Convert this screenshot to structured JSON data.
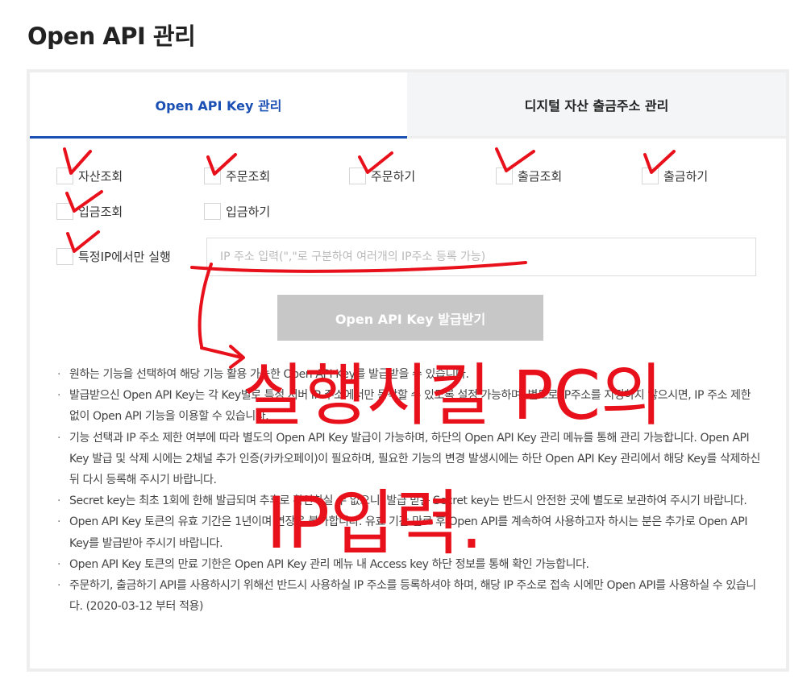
{
  "page": {
    "title": "Open API 관리"
  },
  "tabs": [
    {
      "label": "Open API Key 관리",
      "active": true
    },
    {
      "label": "디지털 자산 출금주소 관리",
      "active": false
    }
  ],
  "permissions": [
    {
      "label": "자산조회",
      "checked": false
    },
    {
      "label": "주문조회",
      "checked": false
    },
    {
      "label": "주문하기",
      "checked": false
    },
    {
      "label": "출금조회",
      "checked": false
    },
    {
      "label": "출금하기",
      "checked": false
    },
    {
      "label": "입금조회",
      "checked": false
    },
    {
      "label": "입금하기",
      "checked": false
    }
  ],
  "ip_restriction": {
    "label": "특정IP에서만 실행",
    "checked": false,
    "value": "",
    "placeholder": "IP 주소 입력(\",\"로 구분하여 여러개의 IP주소 등록 가능)"
  },
  "issue_button": {
    "label": "Open API Key 발급받기",
    "enabled": false
  },
  "notes": [
    "원하는 기능을 선택하여 해당 기능 활용 가능한 Open API Key를 발급받을 수 있습니다.",
    "발급받으신 Open API Key는 각 Key별로 특정 서버 IP 주소에서만 동작할 수 있도록 설정 가능하며, 별도로 IP주소를 지정하지 않으시면, IP 주소 제한 없이 Open API 기능을 이용할 수 있습니다.",
    "기능 선택과 IP 주소 제한 여부에 따라 별도의 Open API Key 발급이 가능하며, 하단의 Open API Key 관리 메뉴를 통해 관리 가능합니다. Open API Key 발급 및 삭제 시에는 2채널 추가 인증(카카오페이)이 필요하며, 필요한 기능의 변경 발생시에는 하단 Open API Key 관리에서 해당 Key를 삭제하신 뒤 다시 등록해 주시기 바랍니다.",
    "Secret key는 최초 1회에 한해 발급되며 추후로 확인하실 수 없으니, 발급 받은 Secret key는 반드시 안전한 곳에 별도로 보관하여 주시기 바랍니다.",
    "Open API Key 토큰의 유효 기간은 1년이며 연장은 불가합니다. 유효 기간 만료 후 Open API를 계속하여 사용하고자 하시는 분은 추가로 Open API Key를 발급받아 주시기 바랍니다.",
    "Open API Key 토큰의 만료 기한은 Open API Key 관리 메뉴 내 Access key 하단 정보를 통해 확인 가능합니다.",
    "주문하기, 출금하기 API를 사용하시기 위해선 반드시 사용하실 IP 주소를 등록하셔야 하며, 해당 IP 주소로 접속 시에만 Open API를 사용하실 수 있습니다. (2020-03-12 부터 적용)"
  ],
  "annotation": {
    "color": "#e8111b",
    "line1": "실행시킬 PC의",
    "line2": "IP입력."
  }
}
